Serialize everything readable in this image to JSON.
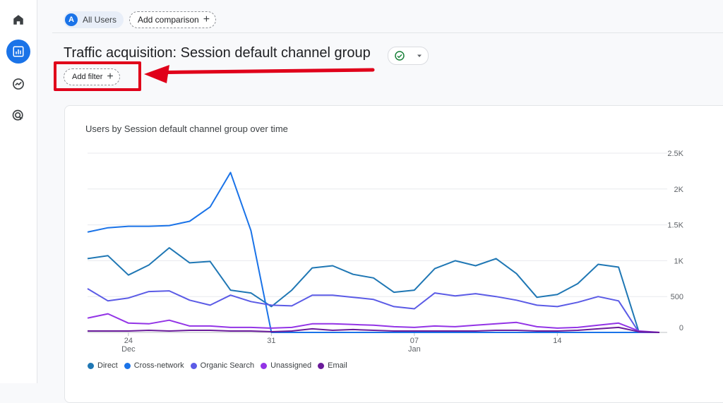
{
  "header": {
    "segment_badge": "A",
    "segment_label": "All Users",
    "add_comparison_label": "Add comparison",
    "add_comparison_icon": "plus-icon"
  },
  "page": {
    "title": "Traffic acquisition: Session default channel group",
    "status_icon": "check-circle-icon",
    "status_dropdown_icon": "caret-down-icon",
    "add_filter_label": "Add filter",
    "add_filter_icon": "plus-icon"
  },
  "sidebar": {
    "items": [
      {
        "name": "home",
        "icon": "home-icon",
        "active": false
      },
      {
        "name": "reports",
        "icon": "bar-chart-icon",
        "active": true
      },
      {
        "name": "explore",
        "icon": "explore-icon",
        "active": false
      },
      {
        "name": "advertising",
        "icon": "advertising-icon",
        "active": false
      }
    ]
  },
  "annotation": {
    "highlight_color": "#e0001a"
  },
  "colors": {
    "accent": "#1a73e8"
  },
  "chart_data": {
    "type": "line",
    "title": "Users by Session default channel group over time",
    "y_ticks": [
      "2.5K",
      "2K",
      "1.5K",
      "1K",
      "500",
      "0"
    ],
    "ylim": [
      0,
      2500
    ],
    "x_tick_labels": [
      {
        "day": "24",
        "month": "Dec",
        "index": 2
      },
      {
        "day": "31",
        "month": "",
        "index": 9
      },
      {
        "day": "07",
        "month": "Jan",
        "index": 16
      },
      {
        "day": "14",
        "month": "",
        "index": 23
      }
    ],
    "x_count": 29,
    "legend_position": "bottom-left",
    "series": [
      {
        "name": "Direct",
        "color": "#1f77b4",
        "values": [
          1030,
          1070,
          800,
          940,
          1180,
          970,
          990,
          590,
          550,
          360,
          590,
          900,
          930,
          810,
          760,
          560,
          590,
          890,
          1000,
          930,
          1030,
          820,
          490,
          530,
          680,
          950,
          910,
          0,
          0
        ]
      },
      {
        "name": "Cross-network",
        "color": "#1a73e8",
        "values": [
          1400,
          1460,
          1480,
          1480,
          1490,
          1550,
          1750,
          2230,
          1420,
          0,
          0,
          0,
          0,
          0,
          0,
          0,
          0,
          0,
          0,
          0,
          0,
          0,
          0,
          0,
          0,
          0,
          0,
          0,
          0
        ]
      },
      {
        "name": "Organic Search",
        "color": "#5b5be6",
        "values": [
          610,
          440,
          480,
          570,
          580,
          450,
          380,
          520,
          430,
          380,
          370,
          520,
          520,
          490,
          460,
          360,
          330,
          550,
          510,
          540,
          500,
          450,
          380,
          360,
          420,
          500,
          440,
          0,
          0
        ]
      },
      {
        "name": "Unassigned",
        "color": "#9334e6",
        "values": [
          200,
          260,
          130,
          120,
          170,
          90,
          90,
          70,
          70,
          60,
          70,
          120,
          120,
          110,
          100,
          80,
          70,
          90,
          80,
          100,
          120,
          140,
          80,
          60,
          70,
          100,
          130,
          20,
          0
        ]
      },
      {
        "name": "Email",
        "color": "#6a1b9a",
        "values": [
          20,
          20,
          20,
          30,
          20,
          30,
          30,
          20,
          20,
          10,
          20,
          50,
          30,
          40,
          30,
          20,
          20,
          20,
          20,
          20,
          30,
          30,
          20,
          20,
          30,
          50,
          70,
          10,
          0
        ]
      }
    ]
  }
}
